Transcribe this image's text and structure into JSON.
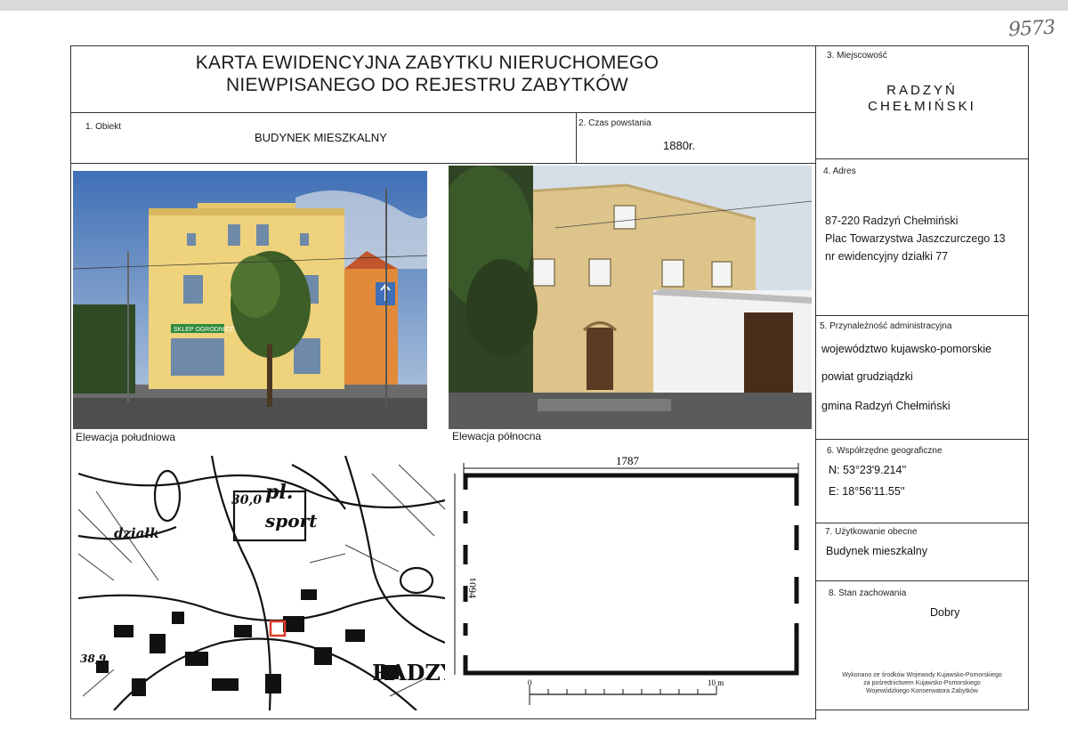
{
  "handwritten_number": "9573",
  "header": {
    "title_line1": "KARTA EWIDENCYJNA ZABYTKU NIERUCHOMEGO",
    "title_line2": "NIEWPISANEGO DO REJESTRU ZABYTKÓW"
  },
  "fields": {
    "obiekt": {
      "label": "1. Obiekt",
      "value": "BUDYNEK MIESZKALNY"
    },
    "czas": {
      "label": "2. Czas powstania",
      "value": "1880r."
    },
    "miejscowosc": {
      "label": "3. Miejscowość",
      "value_line1": "RADZYŃ",
      "value_line2": "CHEŁMIŃSKI"
    },
    "adres": {
      "label": "4. Adres",
      "line1": "87-220 Radzyń Chełmiński",
      "line2": "Plac Towarzystwa Jaszczurczego 13",
      "line3": "nr ewidencyjny działki 77"
    },
    "przynaleznosc": {
      "label": "5. Przynależność administracyjna",
      "line1": "województwo kujawsko-pomorskie",
      "line2": "powiat grudziądzki",
      "line3": "gmina Radzyń Chełmiński"
    },
    "wspolrzedne": {
      "label": "6. Współrzędne geograficzne",
      "n": "N: 53°23'9.214''",
      "e": "E: 18°56'11.55''"
    },
    "uzytkowanie": {
      "label": "7. Użytkowanie obecne",
      "value": "Budynek mieszkalny"
    },
    "stan": {
      "label": "8. Stan zachowania",
      "value": "Dobry"
    }
  },
  "photos": {
    "south_caption": "Elewacja południowa",
    "north_caption": "Elewacja północna",
    "shop_sign": "SKLEP OGRODNICZY"
  },
  "map": {
    "labels": [
      "pl.",
      "sport",
      "działk",
      "30,0",
      "RADZY",
      "38,9"
    ]
  },
  "plan": {
    "width_dim": "1787",
    "height_dim": "1094",
    "scale_start": "0",
    "scale_end": "10 m"
  },
  "footer": {
    "line1": "Wykonano ze środków Wojewody Kujawsko-Pomorskiego",
    "line2": "za pośrednictwem Kujawsko-Pomorskiego",
    "line3": "Wojewódzkiego Konserwatora Zabytków"
  }
}
